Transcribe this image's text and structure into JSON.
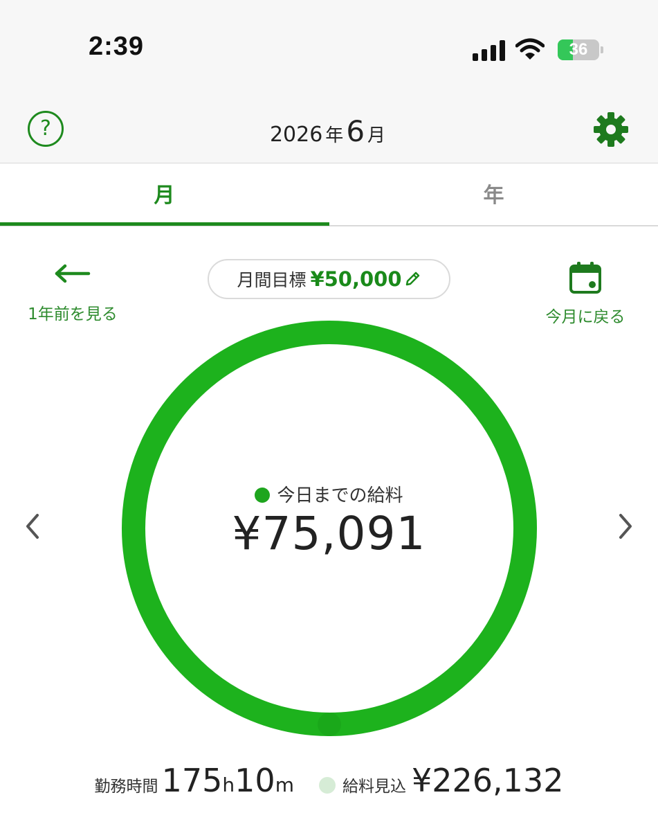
{
  "status_bar": {
    "time": "2:39",
    "battery": "36",
    "battery_level": 0.36
  },
  "nav": {
    "year": "2026",
    "year_unit": "年",
    "month": "6",
    "month_unit": "月",
    "help_icon": "question-circle-icon",
    "settings_icon": "gear-icon"
  },
  "tabs": [
    {
      "label": "月",
      "active": true
    },
    {
      "label": "年",
      "active": false
    }
  ],
  "prev_year": {
    "label": "1年前を見る",
    "icon": "arrow-left-icon"
  },
  "goal": {
    "label": "月間目標",
    "value": "¥50,000",
    "icon": "pencil-icon"
  },
  "back_to_current": {
    "label": "今月に戻る",
    "icon": "calendar-icon"
  },
  "ring": {
    "label": "今日までの給料",
    "value": "¥75,091",
    "progress": 1.0
  },
  "summary": {
    "hours_label": "勤務時間",
    "hours_value": "175",
    "hours_unit": "h",
    "minutes_value": "10",
    "minutes_unit": "m",
    "expected_label": "給料見込",
    "expected_value": "¥226,132"
  },
  "colors": {
    "accent": "#1e8a1e",
    "ring": "#1db21d",
    "expected_dot": "#d6ecd6",
    "background": "#ffffff",
    "bar": "#f7f7f7"
  }
}
